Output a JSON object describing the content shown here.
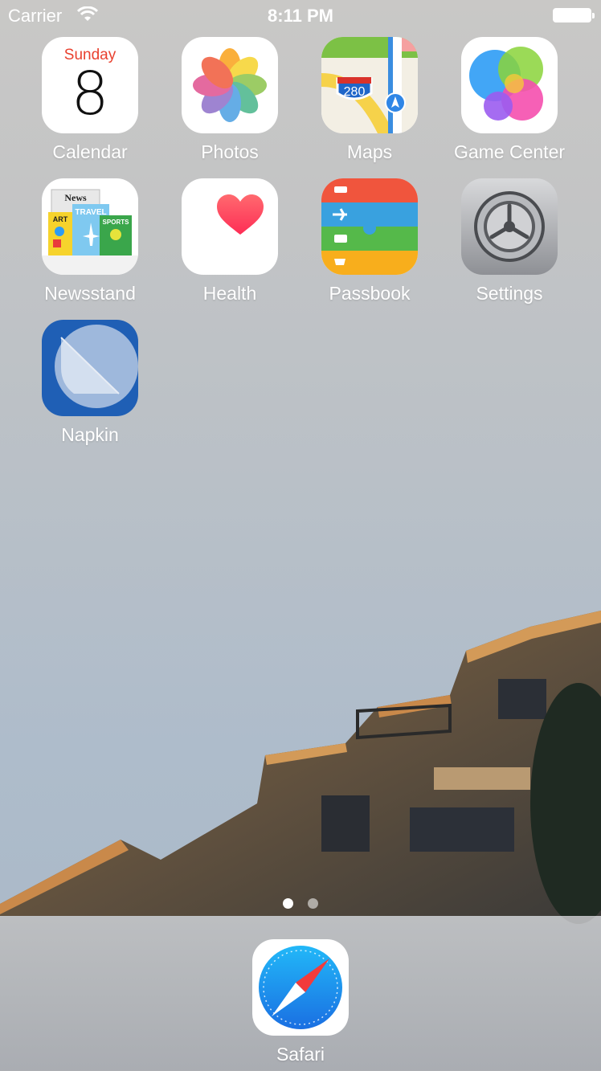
{
  "status_bar": {
    "carrier": "Carrier",
    "time": "8:11 PM"
  },
  "apps": [
    {
      "label": "Calendar",
      "icon": "calendar-icon",
      "day": "Sunday",
      "date": "8"
    },
    {
      "label": "Photos",
      "icon": "photos-icon"
    },
    {
      "label": "Maps",
      "icon": "maps-icon",
      "shield": "280"
    },
    {
      "label": "Game Center",
      "icon": "game-center-icon"
    },
    {
      "label": "Newsstand",
      "icon": "newsstand-icon",
      "magazines": [
        "News",
        "TRAVEL",
        "ART",
        "SPORTS"
      ]
    },
    {
      "label": "Health",
      "icon": "health-icon"
    },
    {
      "label": "Passbook",
      "icon": "passbook-icon"
    },
    {
      "label": "Settings",
      "icon": "settings-icon"
    },
    {
      "label": "Napkin",
      "icon": "napkin-icon"
    }
  ],
  "page_indicator": {
    "pages": 2,
    "current": 1
  },
  "dock": {
    "apps": [
      {
        "label": "Safari",
        "icon": "safari-icon"
      }
    ]
  },
  "colors": {
    "calendar_red": "#e9412f",
    "napkin_blue": "#1f5fb5",
    "health_heart": "#fe3b57",
    "safari_blue": "#1e8ef0"
  }
}
